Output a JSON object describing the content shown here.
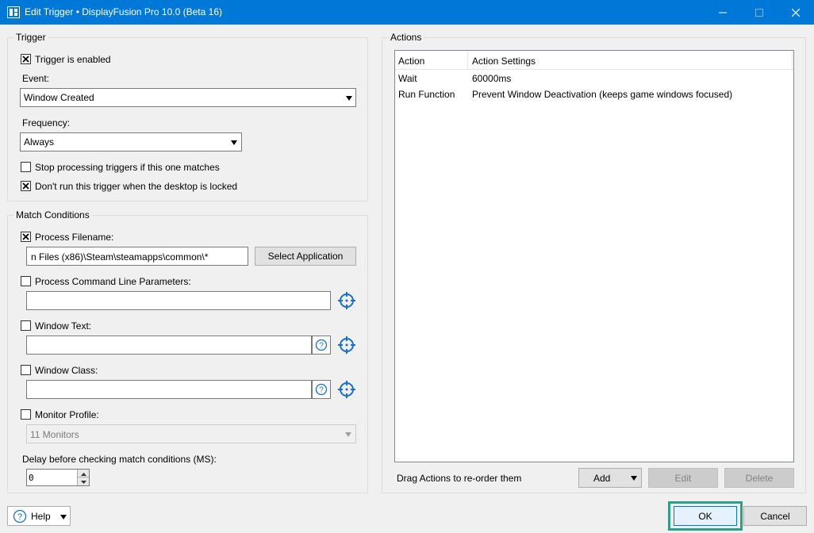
{
  "window": {
    "title": "Edit Trigger • DisplayFusion Pro 10.0 (Beta 16)",
    "app_icon": "displayfusion-icon",
    "controls": [
      "minimize-icon",
      "maximize-icon",
      "close-icon"
    ]
  },
  "trigger": {
    "group_title": "Trigger",
    "enabled_label": "Trigger is enabled",
    "enabled_checked": true,
    "event_label": "Event:",
    "event_value": "Window Created",
    "frequency_label": "Frequency:",
    "frequency_value": "Always",
    "stop_processing_label": "Stop processing triggers if this one matches",
    "stop_processing_checked": false,
    "locked_label": "Don't run this trigger when the desktop is locked",
    "locked_checked": true
  },
  "match": {
    "group_title": "Match Conditions",
    "process_filename_label": "Process Filename:",
    "process_filename_checked": true,
    "process_filename_value": "n Files (x86)\\Steam\\steamapps\\common\\*",
    "select_application_label": "Select Application",
    "cmdline_label": "Process Command Line Parameters:",
    "cmdline_checked": false,
    "cmdline_value": "",
    "window_text_label": "Window Text:",
    "window_text_checked": false,
    "window_text_value": "",
    "window_class_label": "Window Class:",
    "window_class_checked": false,
    "window_class_value": "",
    "monitor_profile_label": "Monitor Profile:",
    "monitor_profile_checked": false,
    "monitor_profile_value": "11 Monitors",
    "delay_label": "Delay before checking match conditions (MS):",
    "delay_value": "0"
  },
  "actions": {
    "group_title": "Actions",
    "columns": [
      "Action",
      "Action Settings"
    ],
    "rows": [
      {
        "action": "Wait",
        "settings": "60000ms"
      },
      {
        "action": "Run Function",
        "settings": "Prevent Window Deactivation (keeps game windows focused)"
      }
    ],
    "drag_hint": "Drag Actions to re-order them",
    "add_label": "Add",
    "edit_label": "Edit",
    "delete_label": "Delete"
  },
  "footer": {
    "help_label": "Help",
    "ok_label": "OK",
    "cancel_label": "Cancel"
  },
  "colors": {
    "titlebar": "#0078d7",
    "ok_highlight": "#2aa187",
    "target_icon": "#1a6fc9"
  }
}
